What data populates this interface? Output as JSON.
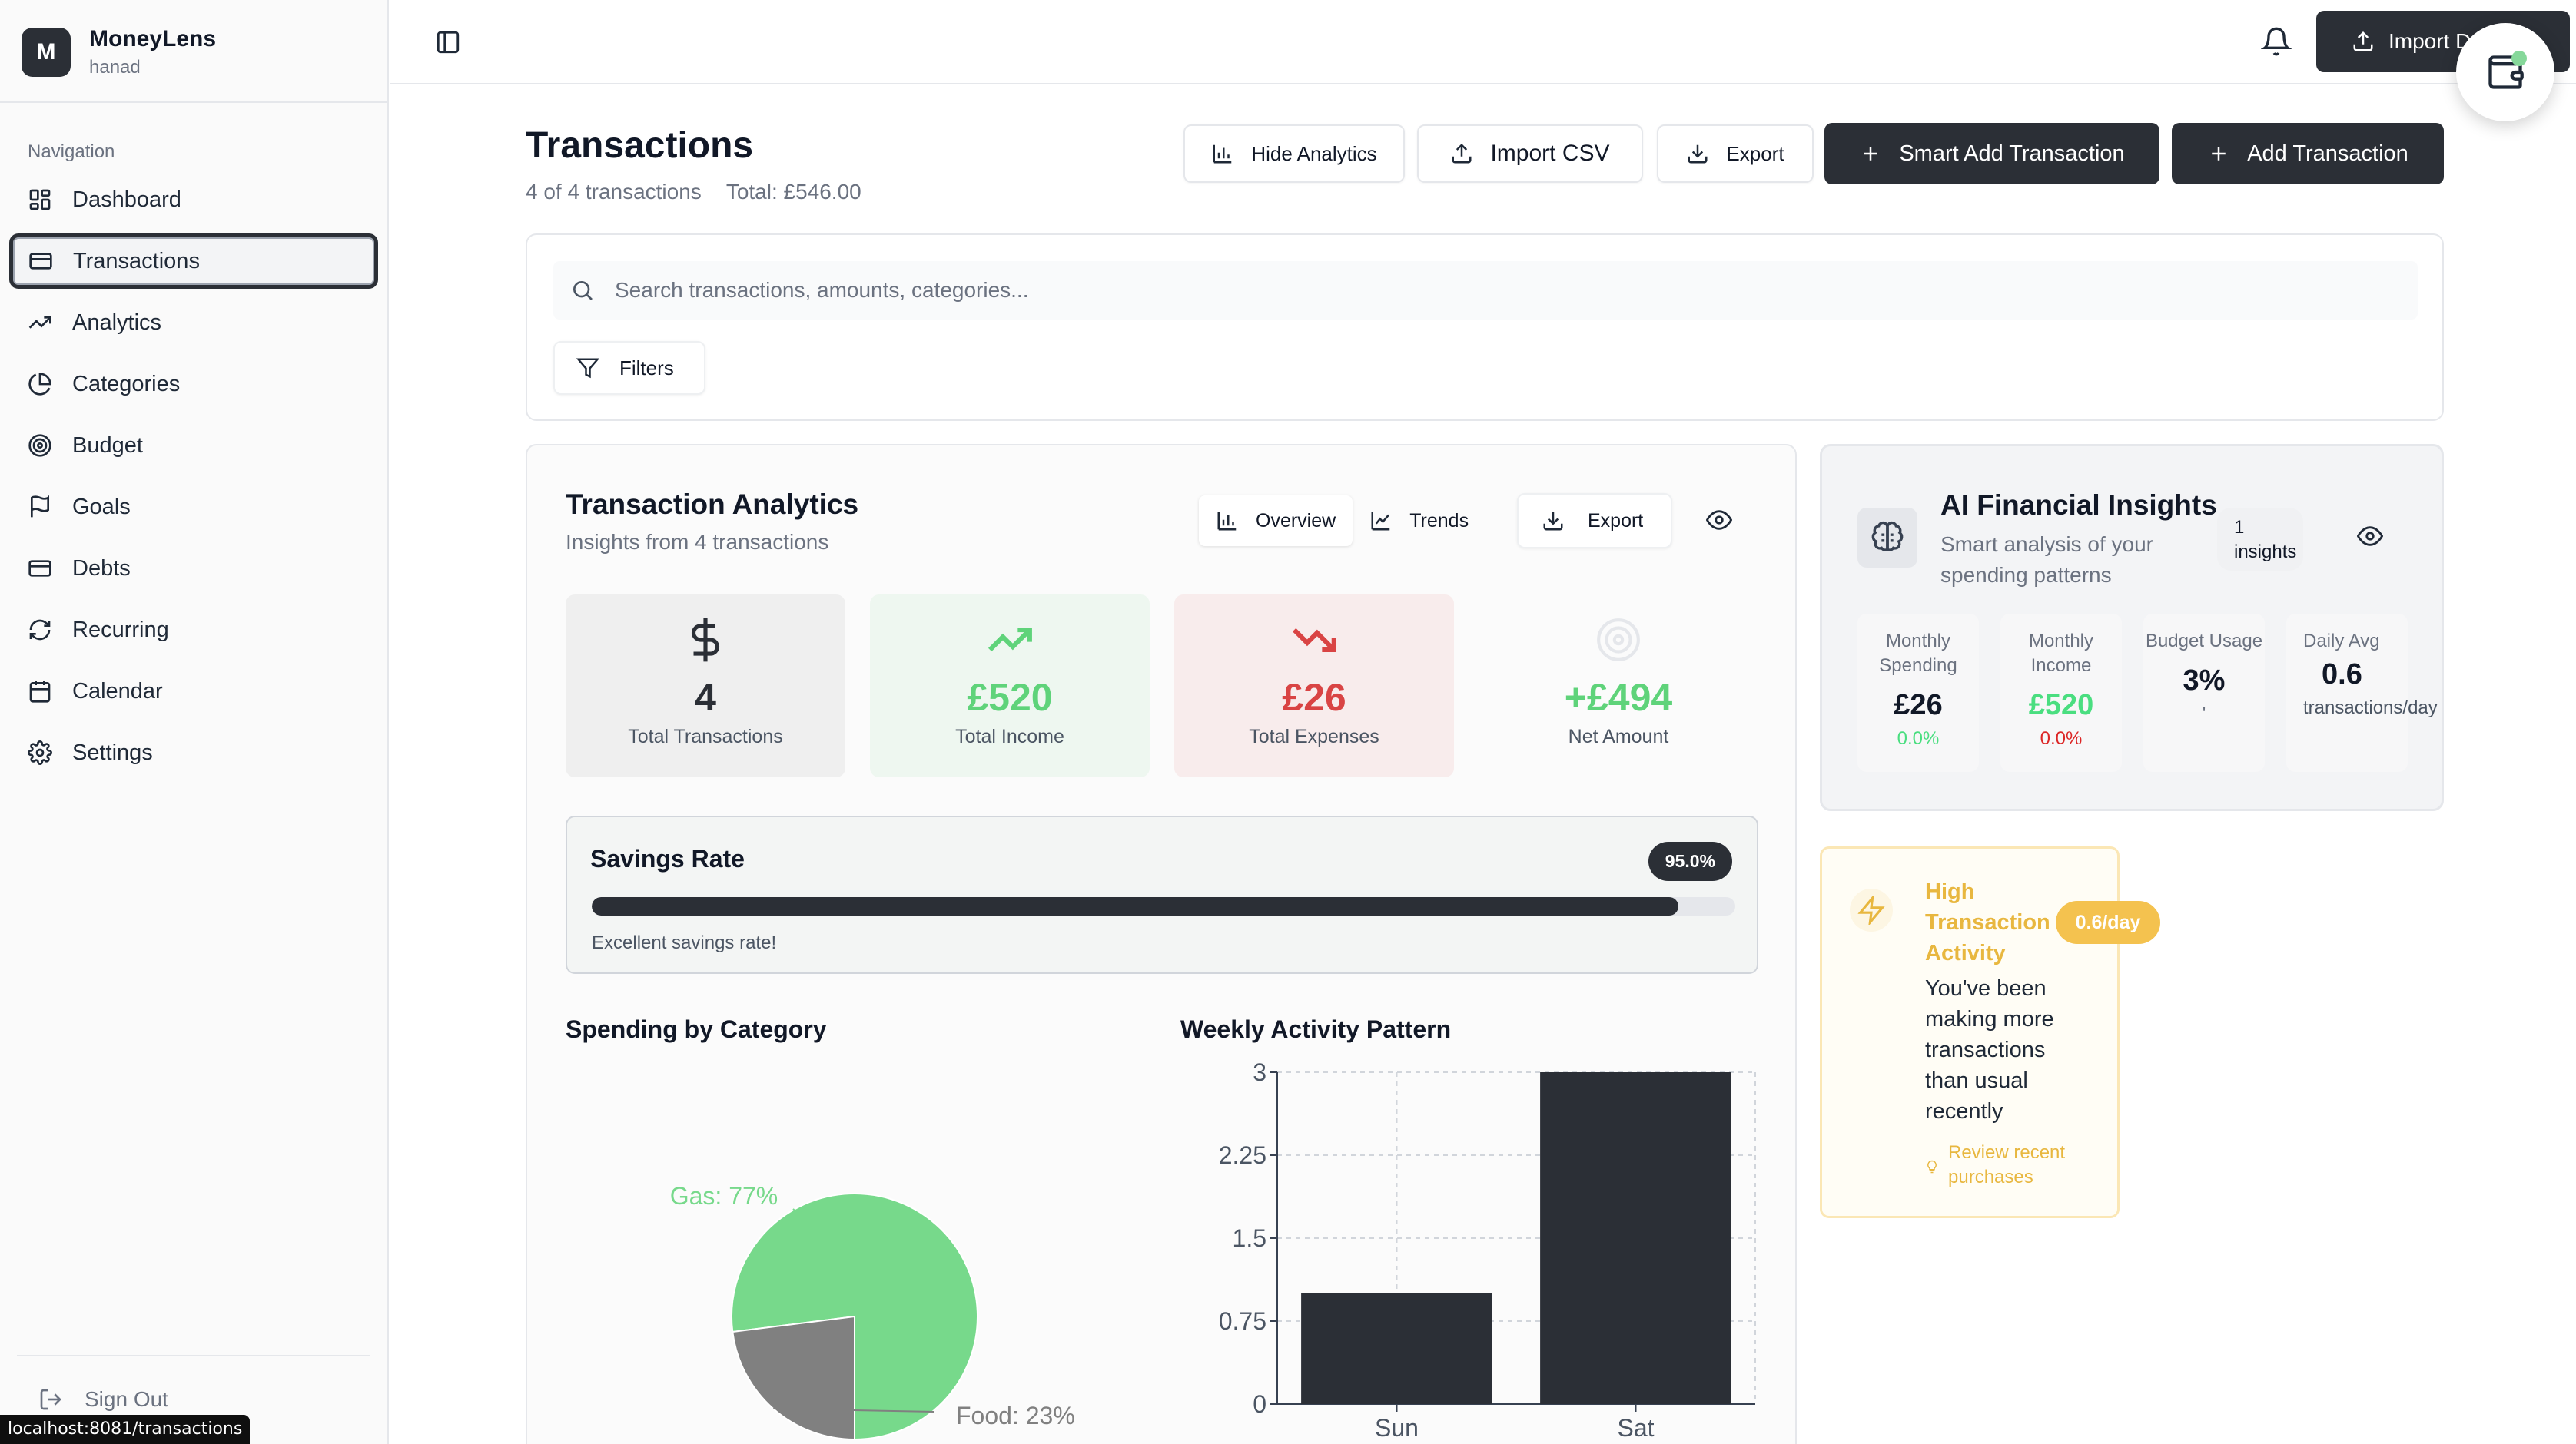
{
  "app": {
    "name": "MoneyLens",
    "user": "hanad",
    "logo_letter": "M"
  },
  "sidebar": {
    "heading": "Navigation",
    "items": [
      {
        "label": "Dashboard",
        "icon": "dashboard-icon"
      },
      {
        "label": "Transactions",
        "icon": "credit-card-icon",
        "active": true
      },
      {
        "label": "Analytics",
        "icon": "trending-up-icon"
      },
      {
        "label": "Categories",
        "icon": "pie-chart-icon"
      },
      {
        "label": "Budget",
        "icon": "target-icon"
      },
      {
        "label": "Goals",
        "icon": "flag-icon"
      },
      {
        "label": "Debts",
        "icon": "credit-card-icon"
      },
      {
        "label": "Recurring",
        "icon": "refresh-icon"
      },
      {
        "label": "Calendar",
        "icon": "calendar-icon"
      },
      {
        "label": "Settings",
        "icon": "gear-icon"
      }
    ],
    "sign_out": "Sign Out"
  },
  "status_url": "localhost:8081/transactions",
  "topbar": {
    "import_label": "Import D"
  },
  "header": {
    "title": "Transactions",
    "count": "4 of 4 transactions",
    "total": "Total: £546.00",
    "buttons": {
      "hide_analytics": "Hide Analytics",
      "import_csv": "Import CSV",
      "export": "Export",
      "smart_add": "Smart Add Transaction",
      "add": "Add Transaction"
    }
  },
  "search": {
    "placeholder": "Search transactions, amounts, categories...",
    "filters_label": "Filters"
  },
  "analytics": {
    "title": "Transaction Analytics",
    "subtitle": "Insights from 4 transactions",
    "tabs": [
      "Overview",
      "Trends"
    ],
    "export_label": "Export",
    "stats": [
      {
        "value": "4",
        "label": "Total Transactions"
      },
      {
        "value": "£520",
        "label": "Total Income"
      },
      {
        "value": "£26",
        "label": "Total Expenses"
      },
      {
        "value": "+£494",
        "label": "Net Amount"
      }
    ],
    "savings": {
      "title": "Savings Rate",
      "badge": "95.0%",
      "rate": 0.95,
      "note": "Excellent savings rate!"
    },
    "spending_title": "Spending by Category",
    "weekly_title": "Weekly Activity Pattern"
  },
  "chart_data": [
    {
      "type": "pie",
      "title": "Spending by Category",
      "slices": [
        {
          "name": "Gas",
          "value": 77,
          "label": "Gas: 77%",
          "color": "#77d98b"
        },
        {
          "name": "Food",
          "value": 23,
          "label": "Food: 23%",
          "color": "#808080"
        }
      ]
    },
    {
      "type": "bar",
      "title": "Weekly Activity Pattern",
      "categories": [
        "Sun",
        "Sat"
      ],
      "values": [
        1,
        3
      ],
      "ylim": [
        0,
        3
      ],
      "yticks": [
        "0",
        "0.75",
        "1.5",
        "2.25",
        "3"
      ],
      "grid": true,
      "color": "#2b2f36"
    }
  ],
  "insights": {
    "title": "AI Financial Insights",
    "subtitle": "Smart analysis of your spending patterns",
    "count": "1 insights",
    "metrics": [
      {
        "label": "Monthly Spending",
        "value": "£26",
        "change": "0.0%",
        "color": "#111827",
        "change_color": "#4ade80"
      },
      {
        "label": "Monthly Income",
        "value": "£520",
        "change": "0.0%",
        "color": "#4ade80",
        "change_color": "#dc2626"
      },
      {
        "label": "Budget Usage",
        "value": "3%",
        "change": "'",
        "color": "#111827",
        "change_color": "#6b7280"
      },
      {
        "label": "Daily Avg",
        "value": "0.6",
        "change": "transactions/day",
        "color": "#111827",
        "change_color": "#4b5563"
      }
    ]
  },
  "activity_alert": {
    "title": "High Transaction Activity",
    "badge": "0.6/day",
    "body": "You've been making more transactions than usual recently",
    "action": "Review recent purchases"
  }
}
